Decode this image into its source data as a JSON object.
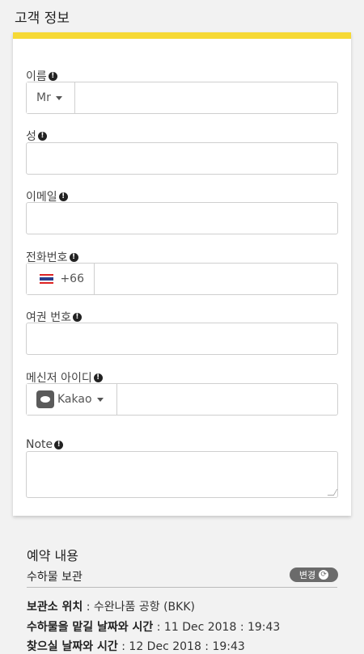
{
  "section_title": "고객 정보",
  "form": {
    "name": {
      "label": "이름",
      "prefix": "Mr",
      "value": ""
    },
    "surname": {
      "label": "성",
      "value": ""
    },
    "email": {
      "label": "이메일",
      "value": ""
    },
    "phone": {
      "label": "전화번호",
      "country_code": "+66",
      "value": ""
    },
    "passport": {
      "label": "여권 번호",
      "value": ""
    },
    "messenger": {
      "label": "메신저 아이디",
      "app": "Kakao",
      "value": ""
    },
    "note": {
      "label": "Note",
      "value": ""
    }
  },
  "summary": {
    "title": "예약 내용",
    "service": "수하물 보관",
    "change_label": "변경",
    "rows": [
      {
        "key": "보관소 위치",
        "value": " : 수완나품 공항 (BKK)"
      },
      {
        "key": "수하물을 맡길 날짜와 시간",
        "value": " : 11 Dec 2018 : 19:43"
      },
      {
        "key": "찾으실 날짜와 시간",
        "value": " : 12 Dec 2018 : 19:43"
      }
    ]
  }
}
